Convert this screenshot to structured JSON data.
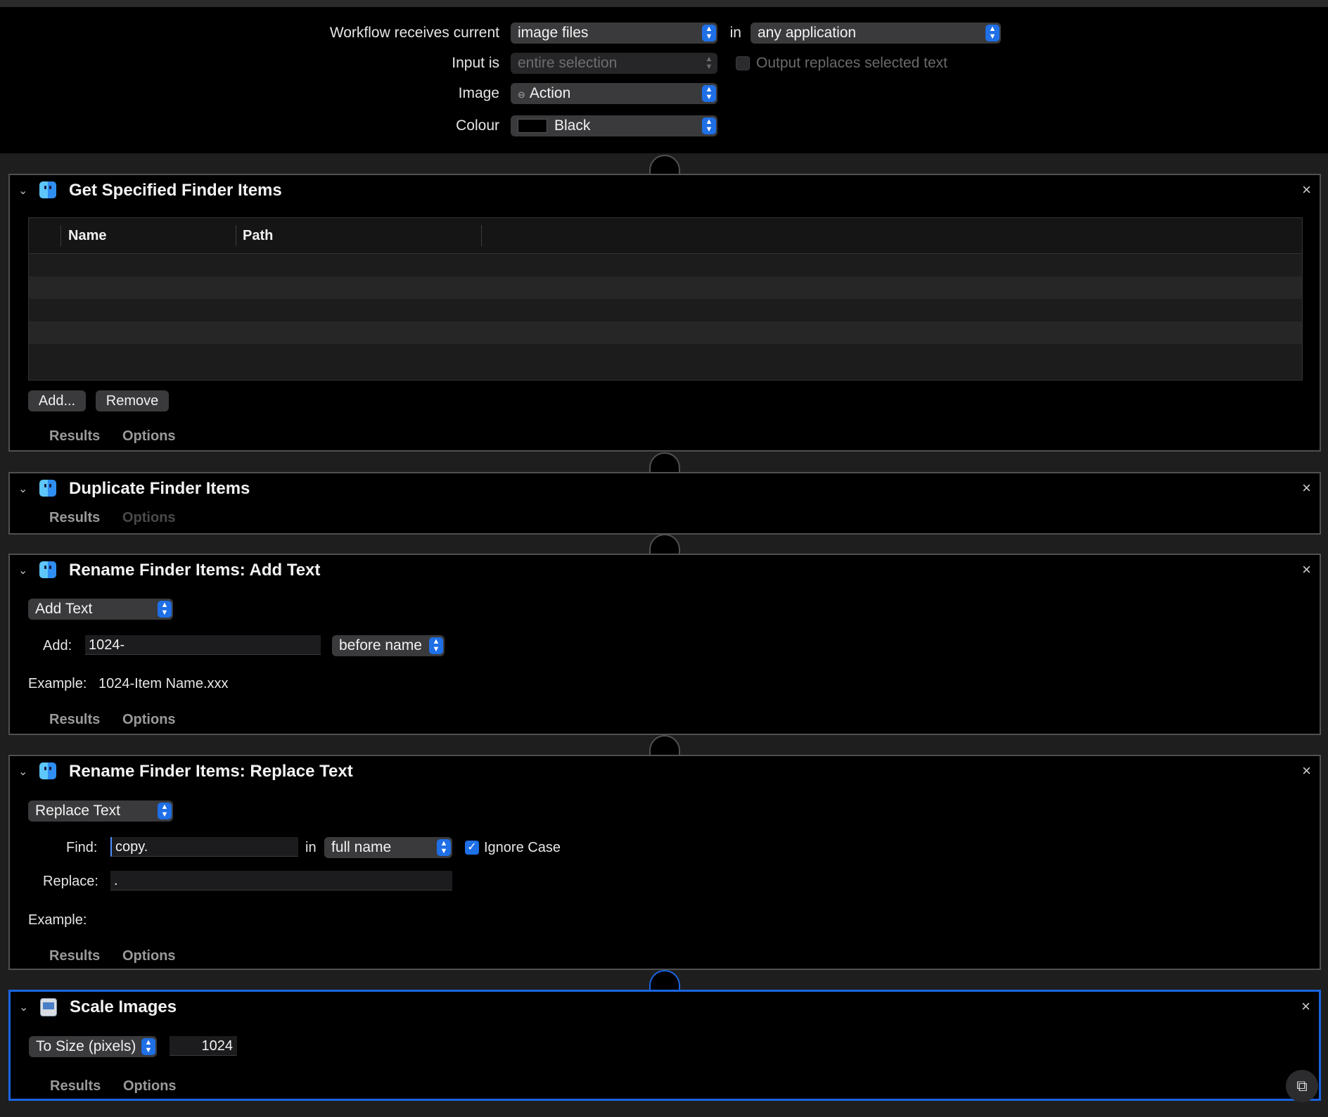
{
  "header": {
    "receives_label": "Workflow receives current",
    "receives_value": "image files",
    "in_label": "in",
    "app_value": "any application",
    "input_is_label": "Input is",
    "input_is_value": "entire selection",
    "output_replaces_label": "Output replaces selected text",
    "image_label": "Image",
    "image_value": "Action",
    "colour_label": "Colour",
    "colour_value": "Black"
  },
  "actions": {
    "get_finder": {
      "title": "Get Specified Finder Items",
      "columns": [
        "Name",
        "Path"
      ],
      "add_label": "Add...",
      "remove_label": "Remove",
      "tab_results": "Results",
      "tab_options": "Options"
    },
    "duplicate": {
      "title": "Duplicate Finder Items",
      "tab_results": "Results",
      "tab_options": "Options"
    },
    "rename_add": {
      "title": "Rename Finder Items: Add Text",
      "mode_value": "Add Text",
      "add_label": "Add:",
      "add_value": "1024-",
      "position_value": "before name",
      "example_label": "Example:",
      "example_value": "1024-Item Name.xxx",
      "tab_results": "Results",
      "tab_options": "Options"
    },
    "rename_replace": {
      "title": "Rename Finder Items: Replace Text",
      "mode_value": "Replace Text",
      "find_label": "Find:",
      "find_value": "copy.",
      "in_label": "in",
      "scope_value": "full name",
      "ignore_case_label": "Ignore Case",
      "replace_label": "Replace:",
      "replace_value": ".",
      "example_label": "Example:",
      "tab_results": "Results",
      "tab_options": "Options"
    },
    "scale": {
      "title": "Scale Images",
      "mode_value": "To Size (pixels)",
      "size_value": "1024",
      "tab_results": "Results",
      "tab_options": "Options"
    }
  },
  "colors": {
    "accent": "#1f6fe6",
    "selected_border": "#1a64e0",
    "background": "#000000"
  },
  "icons": {
    "action_icon": "finder-icon",
    "scale_icon": "preview-icon",
    "screenshot": "live-text-icon"
  }
}
